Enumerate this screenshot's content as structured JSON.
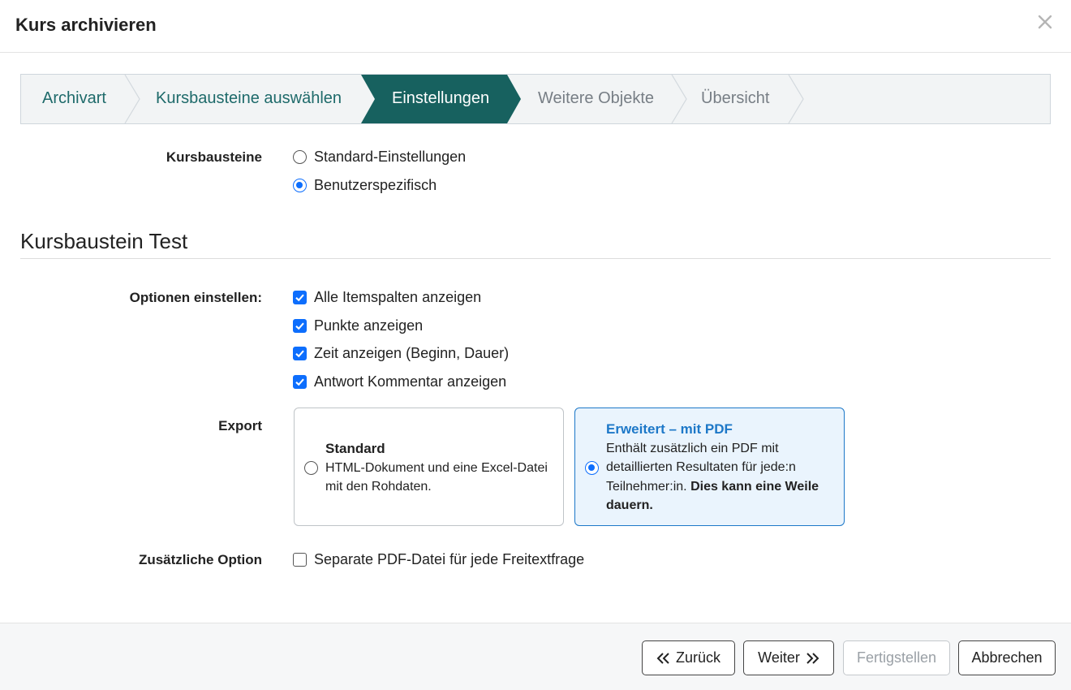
{
  "dialog": {
    "title": "Kurs archivieren"
  },
  "wizard": {
    "steps": [
      {
        "label": "Archivart",
        "state": "done"
      },
      {
        "label": "Kursbausteine auswählen",
        "state": "done"
      },
      {
        "label": "Einstellungen",
        "state": "active"
      },
      {
        "label": "Weitere Objekte",
        "state": "todo"
      },
      {
        "label": "Übersicht",
        "state": "todo"
      }
    ]
  },
  "kursbausteine": {
    "label": "Kursbausteine",
    "options": [
      {
        "label": "Standard-Einstellungen",
        "checked": false
      },
      {
        "label": "Benutzerspezifisch",
        "checked": true
      }
    ]
  },
  "section": {
    "title": "Kursbaustein Test"
  },
  "optionen": {
    "label": "Optionen einstellen:",
    "items": [
      {
        "label": "Alle Itemspalten anzeigen",
        "checked": true
      },
      {
        "label": "Punkte anzeigen",
        "checked": true
      },
      {
        "label": "Zeit anzeigen (Beginn, Dauer)",
        "checked": true
      },
      {
        "label": "Antwort Kommentar anzeigen",
        "checked": true
      }
    ]
  },
  "export": {
    "label": "Export",
    "standard": {
      "title": "Standard",
      "description": "HTML-Dokument und eine Excel-Datei mit den Rohdaten.",
      "selected": false
    },
    "erweitert": {
      "title": "Erweitert – mit PDF",
      "description": "Enthält zusätzlich ein PDF mit detaillierten Resultaten für jede:n Teilnehmer:in.",
      "description_bold": "Dies kann eine Weile dauern.",
      "selected": true
    }
  },
  "zusatz": {
    "label": "Zusätzliche Option",
    "option": {
      "label": "Separate PDF-Datei für jede Freitextfrage",
      "checked": false
    }
  },
  "footer": {
    "back_label": "Zurück",
    "next_label": "Weiter",
    "finish_label": "Fertigstellen",
    "cancel_label": "Abbrechen"
  },
  "colors": {
    "active_step": "#17615f",
    "done_step_text": "#1e6a6a",
    "accent_blue": "#0d6efd",
    "selected_card_bg": "#eaf4fd"
  }
}
